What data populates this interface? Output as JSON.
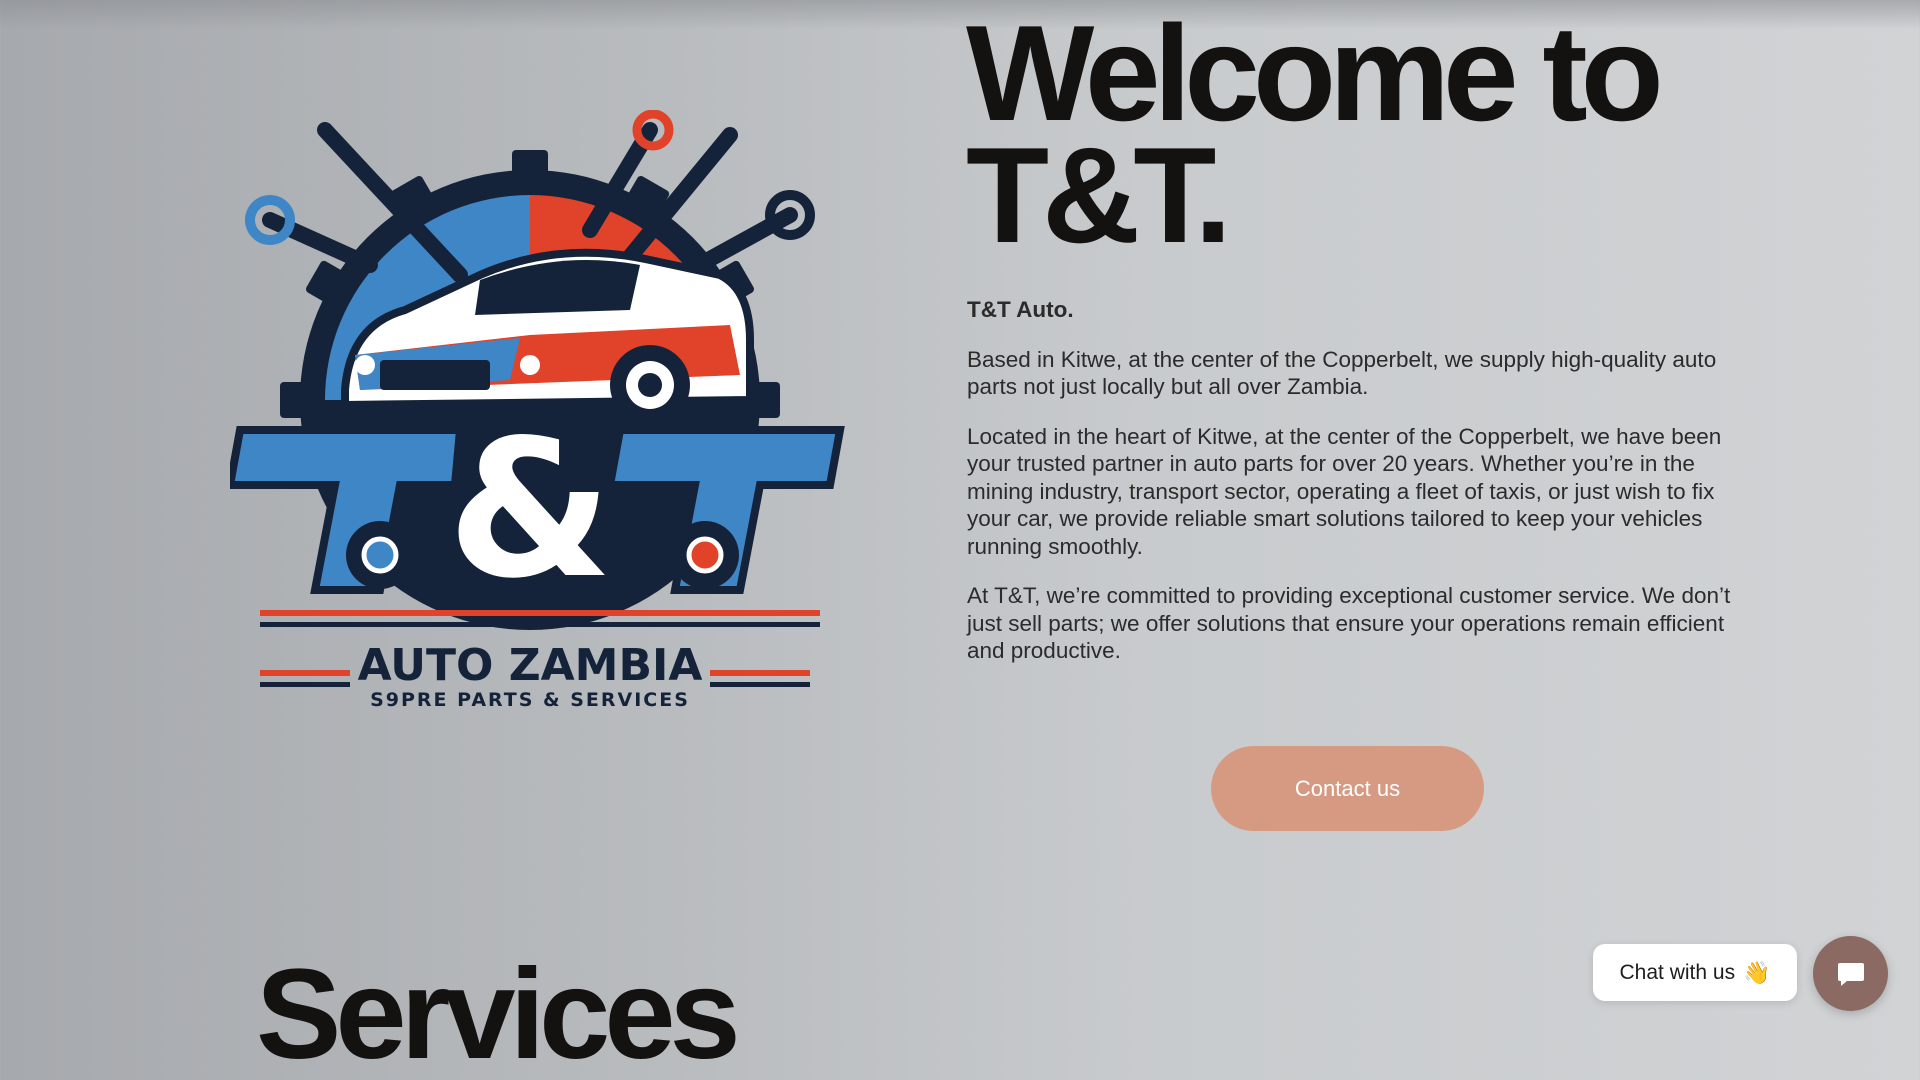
{
  "hero": {
    "title_line1": "Welcome to",
    "title_line2": "T&T."
  },
  "about": {
    "brand": "T&T Auto.",
    "para1": "Based in Kitwe, at the center of the Copperbelt, we supply high-quality auto parts not just locally but all over Zambia.",
    "para2": "Located in the heart of Kitwe, at the center of the Copperbelt, we have been your trusted partner in auto parts for over 20 years. Whether you’re in the mining industry, transport sector, operating a fleet of taxis, or just wish to fix your car, we provide reliable smart solutions tailored to keep your vehicles running smoothly.",
    "para3": "At T&T, we’re committed to providing exceptional customer service. We don’t just sell parts; we offer solutions that ensure your operations remain efficient and productive."
  },
  "cta": {
    "contact_label": "Contact us"
  },
  "logo": {
    "monogram": "T&T",
    "name": "AUTO ZAMBIA",
    "tagline": "S9PRE PARTS & SERVICES"
  },
  "services": {
    "title": "Services"
  },
  "chat": {
    "prompt": "Chat with us",
    "wave_icon": "👋"
  },
  "colors": {
    "button": "#d69a82",
    "chat_launcher": "#8a6a62",
    "logo_blue": "#3f86c6",
    "logo_red": "#e0432a",
    "logo_navy": "#15233a"
  }
}
